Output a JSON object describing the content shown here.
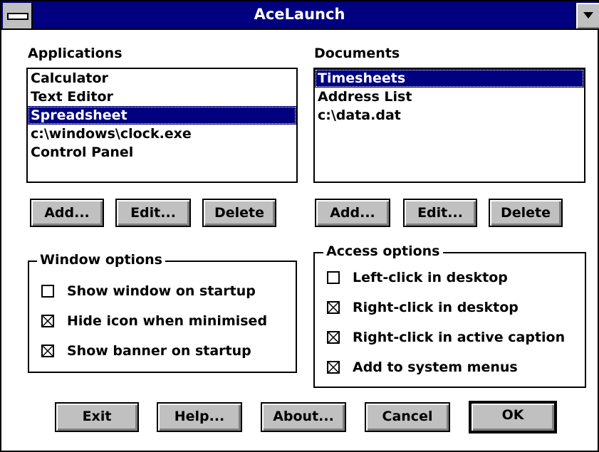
{
  "window": {
    "title": "AceLaunch"
  },
  "applications": {
    "label": "Applications",
    "items": [
      "Calculator",
      "Text Editor",
      "Spreadsheet",
      "c:\\windows\\clock.exe",
      "Control Panel"
    ],
    "selected": "Spreadsheet",
    "buttons": {
      "add": "Add...",
      "edit": "Edit...",
      "delete": "Delete"
    }
  },
  "documents": {
    "label": "Documents",
    "items": [
      "Timesheets",
      "Address List",
      "c:\\data.dat"
    ],
    "selected": "Timesheets",
    "buttons": {
      "add": "Add...",
      "edit": "Edit...",
      "delete": "Delete"
    }
  },
  "window_options": {
    "title": "Window options",
    "options": [
      {
        "label": "Show window on startup",
        "checked": false
      },
      {
        "label": "Hide icon when minimised",
        "checked": true
      },
      {
        "label": "Show banner on startup",
        "checked": true
      }
    ]
  },
  "access_options": {
    "title": "Access options",
    "options": [
      {
        "label": "Left-click in desktop",
        "checked": false
      },
      {
        "label": "Right-click in desktop",
        "checked": true
      },
      {
        "label": "Right-click in active caption",
        "checked": true
      },
      {
        "label": "Add to system menus",
        "checked": true
      }
    ]
  },
  "footer": {
    "exit": "Exit",
    "help": "Help...",
    "about": "About...",
    "cancel": "Cancel",
    "ok": "OK"
  },
  "colors": {
    "title_bar": "#000080",
    "selection": "#000080",
    "button_face": "#c0c0c0"
  }
}
